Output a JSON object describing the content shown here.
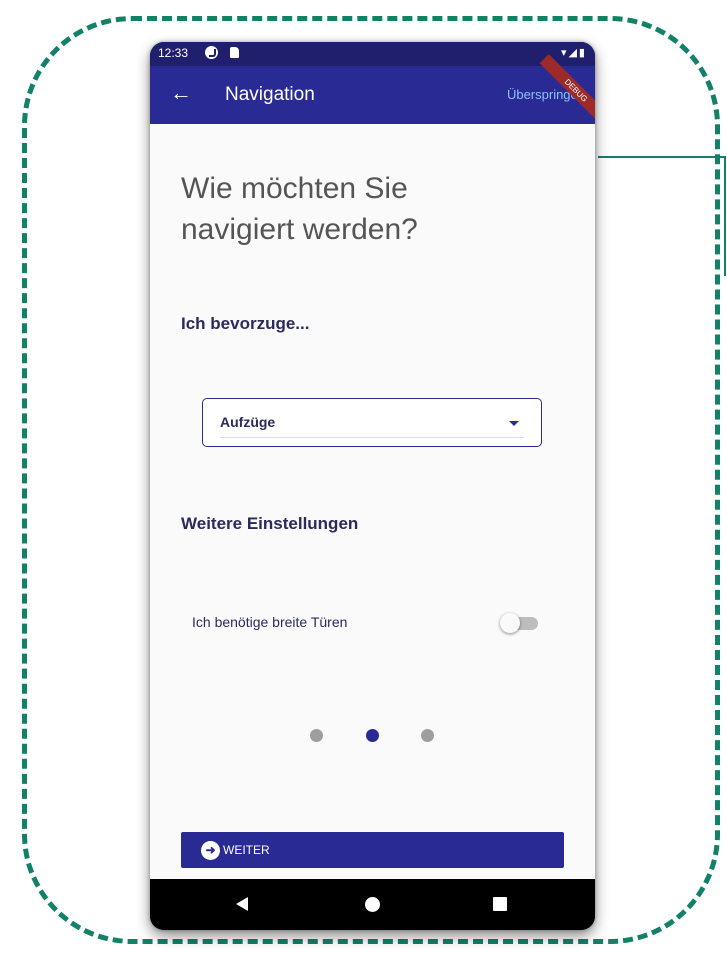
{
  "statusbar": {
    "time": "12:33",
    "icons": "▾◢▮"
  },
  "appbar": {
    "back_icon": "←",
    "title": "Navigation",
    "skip_label": "Überspringen",
    "debug_label": "DEBUG"
  },
  "main": {
    "heading": "Wie möchten Sie navigiert werden?",
    "prefer_label": "Ich bevorzuge...",
    "dropdown_value": "Aufzüge",
    "settings_label": "Weitere Einstellungen",
    "toggle_label": "Ich benötige breite Türen",
    "toggle_on": false,
    "page_indicator": {
      "current": 2,
      "total": 3
    },
    "next_icon": "➜",
    "next_label": "WEITER"
  },
  "colors": {
    "primary": "#2a2a94",
    "status_bar": "#1f1f6e",
    "frame": "#138068",
    "link": "#8ec0ff"
  },
  "icons": [
    "back-arrow-icon",
    "g-icon",
    "sd-card-icon",
    "wifi-icon",
    "signal-icon",
    "battery-icon",
    "dropdown-caret-icon",
    "arrow-circle-icon",
    "nav-back-icon",
    "nav-home-icon",
    "nav-recents-icon"
  ]
}
